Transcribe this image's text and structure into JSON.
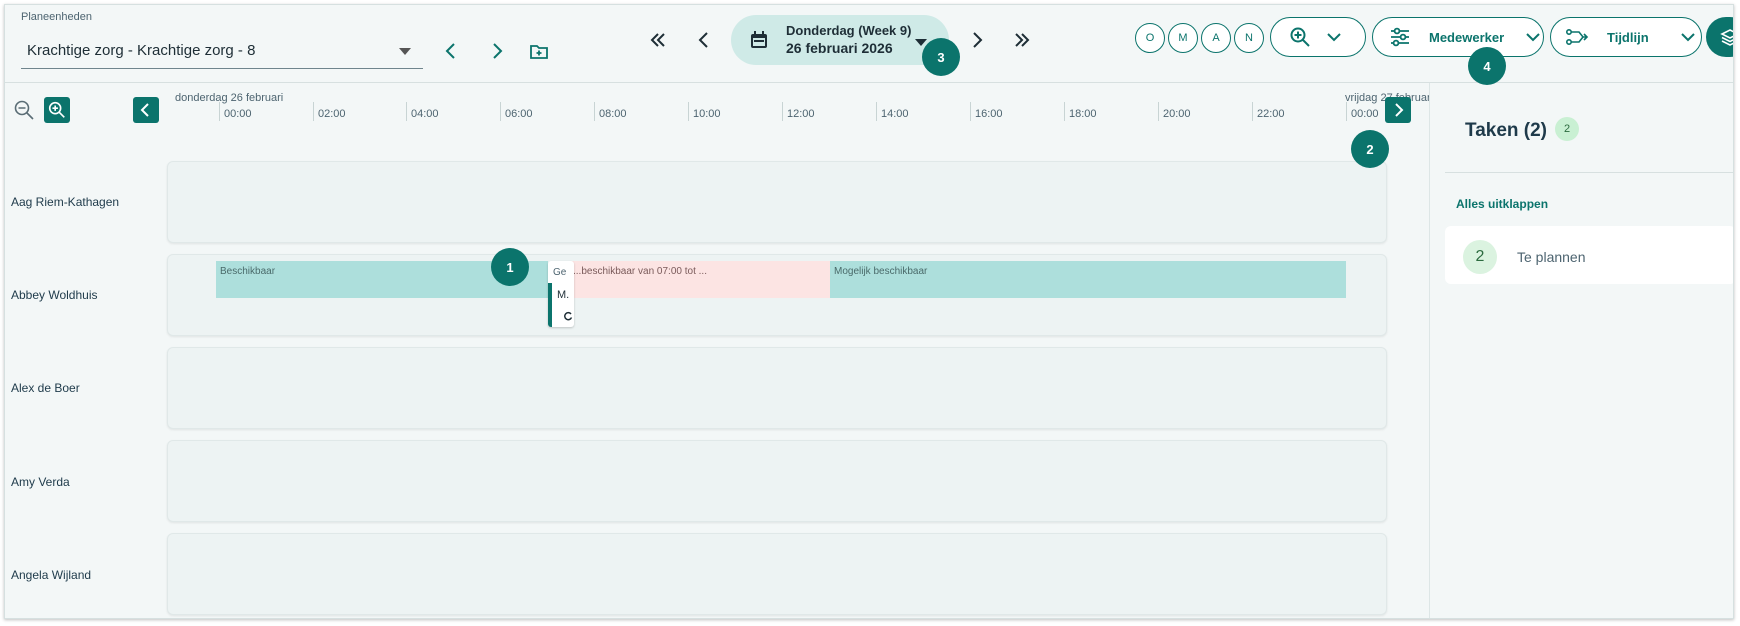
{
  "header": {
    "planning_units_label": "Planeenheden",
    "planning_unit_value": "Krachtige zorg - Krachtige zorg - 8",
    "date_line1": "Donderdag (Week 9)",
    "date_line2": "26 februari 2026",
    "shift_filters": [
      "O",
      "M",
      "A",
      "N"
    ],
    "view_mode_label": "Medewerker",
    "timeline_label": "Tijdlijn"
  },
  "timeline": {
    "date_left": "donderdag 26 februari",
    "date_right": "vrijdag 27 februari",
    "hours": [
      "00:00",
      "02:00",
      "04:00",
      "06:00",
      "08:00",
      "10:00",
      "12:00",
      "14:00",
      "16:00",
      "18:00",
      "20:00",
      "22:00",
      "00:00"
    ]
  },
  "employees": [
    {
      "name": "Aag Riem-Kathagen"
    },
    {
      "name": "Abbey Woldhuis"
    },
    {
      "name": "Alex de Boer"
    },
    {
      "name": "Amy Verda"
    },
    {
      "name": "Angela Wijland"
    }
  ],
  "availability": {
    "available_label": "Beschikbaar",
    "task_short_label": "Ge",
    "task_detail_label": "M.",
    "unavailable_label": "...beschikbaar van 07:00 tot ...",
    "maybe_label": "Mogelijk beschikbaar"
  },
  "badges": [
    "1",
    "2",
    "3",
    "4"
  ],
  "panel": {
    "title": "Taken (2)",
    "count": "2",
    "expand_all": "Alles uitklappen",
    "task_group_count": "2",
    "task_group_label": "Te plannen"
  },
  "colors": {
    "primary": "#0b746c",
    "available": "#addfdc",
    "unavailable": "#fce4e3",
    "pill": "#cfeae7"
  }
}
